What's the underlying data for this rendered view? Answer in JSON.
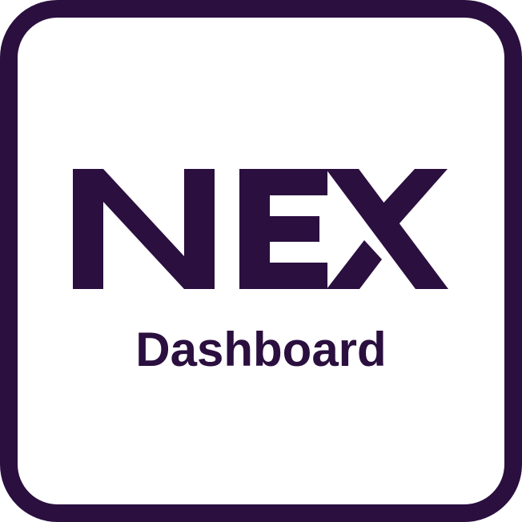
{
  "brand": {
    "wordmark": "NEX",
    "product": "Dashboard"
  },
  "colors": {
    "primary": "#2a0f3f",
    "background": "#ffffff"
  }
}
